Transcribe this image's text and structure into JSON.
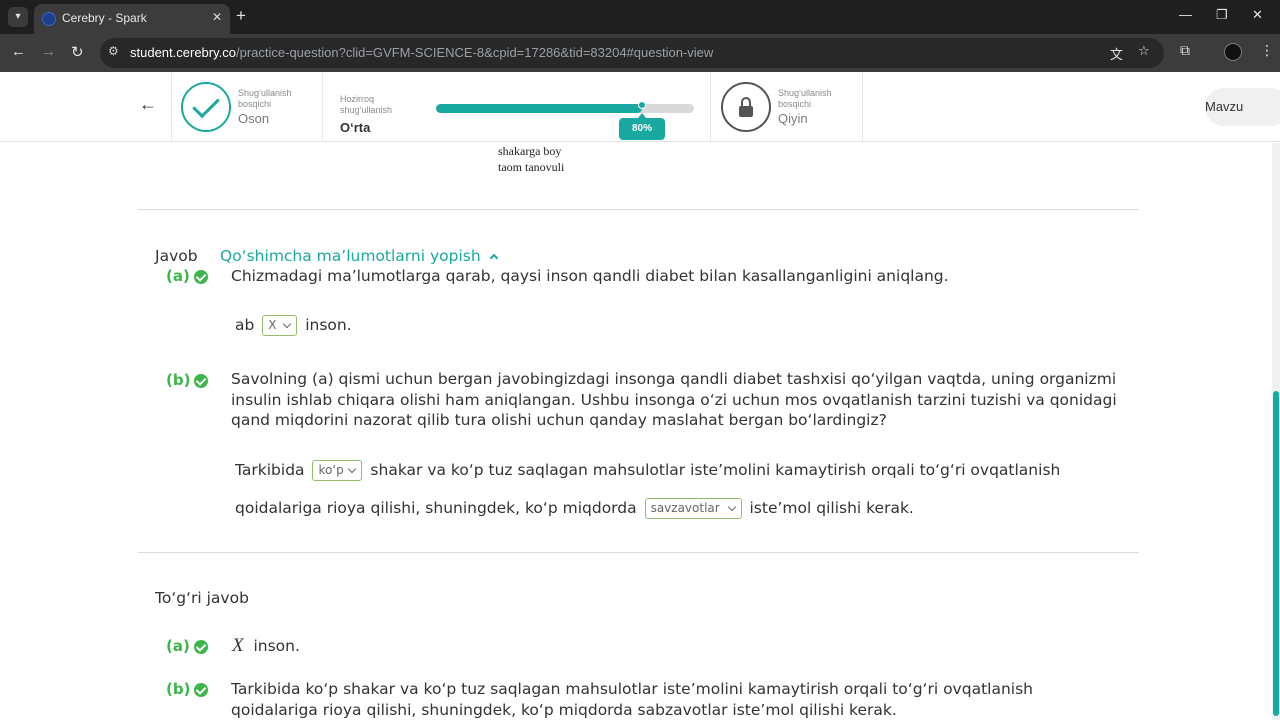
{
  "browser": {
    "tab_title": "Cerebry - Spark",
    "tab_close": "✕",
    "new_tab": "+",
    "url_host": "student.cerebry.co",
    "url_path": "/practice-question?clid=GVFM-SCIENCE-8&cpid=17286&tid=83204#question-view",
    "window_controls": [
      "—",
      "❐",
      "✕"
    ]
  },
  "header": {
    "back_arrow": "←",
    "level_easy": {
      "caption": "Shug‘ullanish bosqichi",
      "name": "Oson"
    },
    "level_current": {
      "caption": "Hozirroq shug‘ullanish",
      "name": "O‘rta"
    },
    "progress": {
      "percent": 80,
      "label": "80%"
    },
    "level_hard": {
      "caption": "Shug‘ullanish bosqichi",
      "name": "Qiyin"
    },
    "topic_button": "Mavzu"
  },
  "figure_fragment": {
    "line1": "shakarga boy",
    "line2": "taom tanovuli"
  },
  "answer": {
    "label": "Javob",
    "toggle": "Qo‘shimcha ma’lumotlarni yopish",
    "part_a": {
      "label": "(a)",
      "question": "Chizmadagi ma’lumotlarga qarab, qaysi inson qandli diabet bilan kasallanganligini aniqlang.",
      "prefix": "ab",
      "select": "X",
      "suffix": "inson."
    },
    "part_b": {
      "label": "(b)",
      "question": "Savolning (a) qismi uchun bergan javobingizdagi insonga qandli diabet tashxisi qo‘yilgan vaqtda, uning organizmi insulin ishlab chiqara olishi ham aniqlangan. Ushbu insonga o‘zi uchun mos ovqatlanish tarzini tuzishi va qonidagi qand miqdorini nazorat qilib tura olishi uchun qanday maslahat bergan bo‘lardingiz?",
      "line1_prefix": "Tarkibida",
      "select1": "ko‘p",
      "line1_suffix": "shakar va ko‘p tuz saqlagan mahsulotlar iste’molini kamaytirish orqali to‘g‘ri ovqatlanish",
      "line2_prefix": "qoidalariga rioya qilishi, shuningdek, ko‘p miqdorda",
      "select2": "savzavotlar",
      "line2_suffix": "iste’mol qilishi kerak."
    }
  },
  "correct_answer": {
    "title": "To‘g‘ri javob",
    "part_a": {
      "label": "(a)",
      "value": "X",
      "suffix": "inson."
    },
    "part_b": {
      "label": "(b)",
      "text": "Tarkibida ko‘p shakar va ko‘p tuz saqlagan mahsulotlar iste’molini kamaytirish orqali to‘g‘ri ovqatlanish qoidalariga rioya qilishi, shuningdek, ko‘p miqdorda sabzavotlar iste’mol qilishi kerak."
    }
  },
  "colors": {
    "accent": "#1aa9a0",
    "correct": "#3cb54a"
  }
}
